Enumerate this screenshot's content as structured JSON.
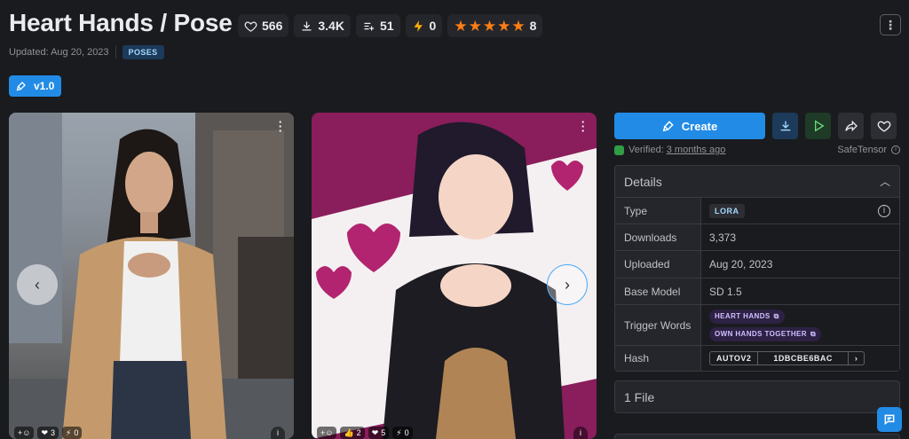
{
  "model": {
    "title": "Heart Hands / Pose",
    "updated": "Updated: Aug 20, 2023",
    "category": "POSES",
    "version": "v1.0"
  },
  "stats": {
    "likes": "566",
    "downloads": "3.4K",
    "collections": "51",
    "tips": "0",
    "rating_count": "8",
    "rating_stars": 5
  },
  "images": [
    {
      "reactions": [
        {
          "icon": "plus-smile",
          "count": ""
        },
        {
          "icon": "heart",
          "count": "3"
        },
        {
          "icon": "bolt",
          "count": "0"
        }
      ]
    },
    {
      "reactions": [
        {
          "icon": "plus-smile",
          "count": ""
        },
        {
          "icon": "like",
          "count": "2"
        },
        {
          "icon": "heart",
          "count": "5"
        },
        {
          "icon": "bolt",
          "count": "0"
        }
      ]
    }
  ],
  "sidebar": {
    "create_label": "Create",
    "verified_prefix": "Verified:",
    "verified_time": "3 months ago",
    "safetensor": "SafeTensor",
    "details_title": "Details",
    "details": {
      "type_key": "Type",
      "type_val": "LORA",
      "downloads_key": "Downloads",
      "downloads_val": "3,373",
      "uploaded_key": "Uploaded",
      "uploaded_val": "Aug 20, 2023",
      "base_key": "Base Model",
      "base_val": "SD 1.5",
      "trigger_key": "Trigger Words",
      "triggers": [
        "HEART HANDS",
        "OWN HANDS TOGETHER"
      ],
      "hash_key": "Hash",
      "hash_type": "AUTOV2",
      "hash_val": "1DBCBE6BAC"
    },
    "files_label": "1 File"
  },
  "colors": {
    "accent": "#228be6",
    "star": "#fd7e14",
    "background": "#1a1b1e"
  }
}
